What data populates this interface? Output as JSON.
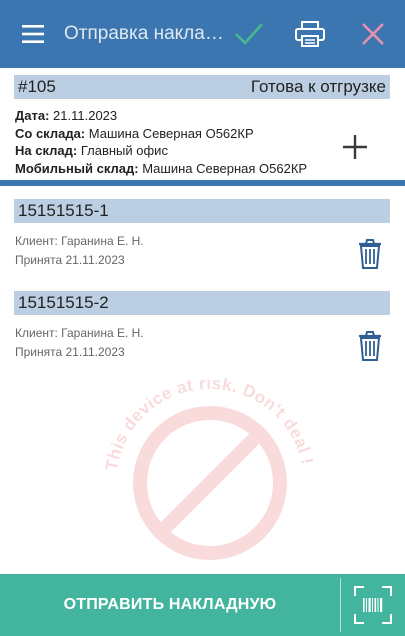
{
  "colors": {
    "topbar": "#3c76b0",
    "section_bar": "#bccfe2",
    "accent_green": "#43b59f",
    "check_green": "#48b893",
    "close_pink": "#e68fae",
    "trash_blue": "#2f5f93"
  },
  "topbar": {
    "menu_icon": "hamburger-icon",
    "title": "Отправка накладной",
    "confirm_icon": "checkmark-icon",
    "print_icon": "printer-icon",
    "close_icon": "close-icon"
  },
  "header": {
    "number": "#105",
    "status": "Готова к отгрузке",
    "date_label": "Дата:",
    "date_value": "21.11.2023",
    "from_label": "Со склада:",
    "from_value": "Машина Северная О562КР",
    "to_label": "На склад:",
    "to_value": "Главный офис",
    "mobile_label": "Мобильный склад:",
    "mobile_value": "Машина Северная О562КР",
    "add_icon": "plus-icon"
  },
  "items": [
    {
      "code": "15151515-1",
      "client": "Клиент: Гаранина Е. Н.",
      "accepted": "Принята 21.11.2023",
      "delete_icon": "trash-icon"
    },
    {
      "code": "15151515-2",
      "client": "Клиент: Гаранина Е. Н.",
      "accepted": "Принята 21.11.2023",
      "delete_icon": "trash-icon"
    }
  ],
  "watermark": {
    "text": "This device at risk. Don't deal !",
    "icon": "prohibited-icon"
  },
  "bottombar": {
    "send_label": "ОТПРАВИТЬ НАКЛАДНУЮ",
    "scan_icon": "barcode-scan-icon"
  }
}
